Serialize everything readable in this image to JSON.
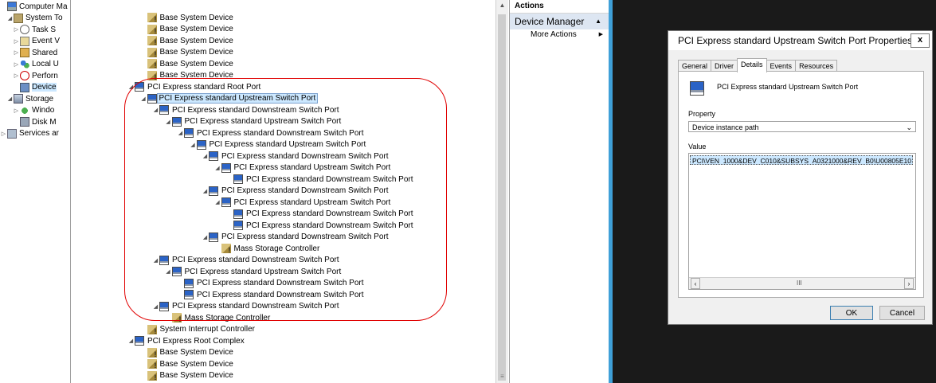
{
  "nav": {
    "items": [
      {
        "label": "Computer Ma",
        "arrow": "",
        "icon": "computer-management-icon",
        "cls": "i-comp",
        "indent": 0
      },
      {
        "label": "System To",
        "arrow": "◢",
        "icon": "system-tools-icon",
        "cls": "i-tools",
        "indent": 1
      },
      {
        "label": "Task S",
        "arrow": "▷",
        "icon": "task-scheduler-icon",
        "cls": "i-clock",
        "indent": 2
      },
      {
        "label": "Event V",
        "arrow": "▷",
        "icon": "event-viewer-icon",
        "cls": "i-event",
        "indent": 2
      },
      {
        "label": "Shared",
        "arrow": "▷",
        "icon": "shared-folders-icon",
        "cls": "i-share",
        "indent": 2
      },
      {
        "label": "Local U",
        "arrow": "▷",
        "icon": "local-users-icon",
        "cls": "i-users",
        "indent": 2
      },
      {
        "label": "Perforn",
        "arrow": "▷",
        "icon": "performance-icon",
        "cls": "i-perf",
        "indent": 2
      },
      {
        "label": "Device",
        "arrow": "",
        "icon": "device-manager-icon",
        "cls": "i-dev",
        "indent": 2,
        "selected": true
      },
      {
        "label": "Storage",
        "arrow": "◢",
        "icon": "storage-icon",
        "cls": "i-storage",
        "indent": 1
      },
      {
        "label": "Windo",
        "arrow": "▷",
        "icon": "windows-backup-icon",
        "cls": "i-backup",
        "indent": 2
      },
      {
        "label": "Disk M",
        "arrow": "",
        "icon": "disk-management-icon",
        "cls": "i-disk",
        "indent": 2
      },
      {
        "label": "Services ar",
        "arrow": "▷",
        "icon": "services-icon",
        "cls": "i-svc",
        "indent": 0
      }
    ]
  },
  "tree": {
    "rows": [
      {
        "label": "Base System Device",
        "indent": 5,
        "arrow": "",
        "icon": "warn"
      },
      {
        "label": "Base System Device",
        "indent": 5,
        "arrow": "",
        "icon": "warn"
      },
      {
        "label": "Base System Device",
        "indent": 5,
        "arrow": "",
        "icon": "warn"
      },
      {
        "label": "Base System Device",
        "indent": 5,
        "arrow": "",
        "icon": "warn"
      },
      {
        "label": "Base System Device",
        "indent": 5,
        "arrow": "",
        "icon": "warn"
      },
      {
        "label": "Base System Device",
        "indent": 5,
        "arrow": "",
        "icon": "warn"
      },
      {
        "label": "PCI Express standard Root Port",
        "indent": 4,
        "arrow": "◢",
        "icon": "pci"
      },
      {
        "label": "PCI Express standard Upstream Switch Port",
        "indent": 5,
        "arrow": "◢",
        "icon": "pci",
        "selected": true
      },
      {
        "label": "PCI Express standard Downstream Switch Port",
        "indent": 6,
        "arrow": "◢",
        "icon": "pci"
      },
      {
        "label": "PCI Express standard Upstream Switch Port",
        "indent": 7,
        "arrow": "◢",
        "icon": "pci"
      },
      {
        "label": "PCI Express standard Downstream Switch Port",
        "indent": 8,
        "arrow": "◢",
        "icon": "pci"
      },
      {
        "label": "PCI Express standard Upstream Switch Port",
        "indent": 9,
        "arrow": "◢",
        "icon": "pci"
      },
      {
        "label": "PCI Express standard Downstream Switch Port",
        "indent": 10,
        "arrow": "◢",
        "icon": "pci"
      },
      {
        "label": "PCI Express standard Upstream Switch Port",
        "indent": 11,
        "arrow": "◢",
        "icon": "pci"
      },
      {
        "label": "PCI Express standard Downstream Switch Port",
        "indent": 12,
        "arrow": "",
        "icon": "pci"
      },
      {
        "label": "PCI Express standard Downstream Switch Port",
        "indent": 10,
        "arrow": "◢",
        "icon": "pci"
      },
      {
        "label": "PCI Express standard Upstream Switch Port",
        "indent": 11,
        "arrow": "◢",
        "icon": "pci"
      },
      {
        "label": "PCI Express standard Downstream Switch Port",
        "indent": 12,
        "arrow": "",
        "icon": "pci"
      },
      {
        "label": "PCI Express standard Downstream Switch Port",
        "indent": 12,
        "arrow": "",
        "icon": "pci"
      },
      {
        "label": "PCI Express standard Downstream Switch Port",
        "indent": 10,
        "arrow": "◢",
        "icon": "pci"
      },
      {
        "label": "Mass Storage Controller",
        "indent": 11,
        "arrow": "",
        "icon": "warn"
      },
      {
        "label": "PCI Express standard Downstream Switch Port",
        "indent": 6,
        "arrow": "◢",
        "icon": "pci"
      },
      {
        "label": "PCI Express standard Upstream Switch Port",
        "indent": 7,
        "arrow": "◢",
        "icon": "pci"
      },
      {
        "label": "PCI Express standard Downstream Switch Port",
        "indent": 8,
        "arrow": "",
        "icon": "pci"
      },
      {
        "label": "PCI Express standard Downstream Switch Port",
        "indent": 8,
        "arrow": "",
        "icon": "pci"
      },
      {
        "label": "PCI Express standard Downstream Switch Port",
        "indent": 6,
        "arrow": "◢",
        "icon": "pci"
      },
      {
        "label": "Mass Storage Controller",
        "indent": 7,
        "arrow": "",
        "icon": "warn"
      },
      {
        "label": "System Interrupt Controller",
        "indent": 5,
        "arrow": "",
        "icon": "warn"
      },
      {
        "label": "PCI Express Root Complex",
        "indent": 4,
        "arrow": "◢",
        "icon": "pci"
      },
      {
        "label": "Base System Device",
        "indent": 5,
        "arrow": "",
        "icon": "warn"
      },
      {
        "label": "Base System Device",
        "indent": 5,
        "arrow": "",
        "icon": "warn"
      },
      {
        "label": "Base System Device",
        "indent": 5,
        "arrow": "",
        "icon": "warn"
      }
    ]
  },
  "actions": {
    "header": "Actions",
    "section": "Device Manager",
    "more": "More Actions"
  },
  "dialog": {
    "title": "PCI Express standard Upstream Switch Port Properties",
    "close": "x",
    "tabs": [
      "General",
      "Driver",
      "Details",
      "Events",
      "Resources"
    ],
    "active_tab": "Details",
    "device_name": "PCI Express standard Upstream Switch Port",
    "property_label": "Property",
    "property_value": "Device instance path",
    "value_label": "Value",
    "value": "PCI\\VEN_1000&DEV_C010&SUBSYS_A0321000&REV_B0\\U00805E10",
    "ok": "OK",
    "cancel": "Cancel"
  },
  "colors": {
    "highlight": "#e00000",
    "selection": "#cce8ff",
    "divider": "#3fa0d8",
    "dark_background": "#1a1a1a"
  }
}
